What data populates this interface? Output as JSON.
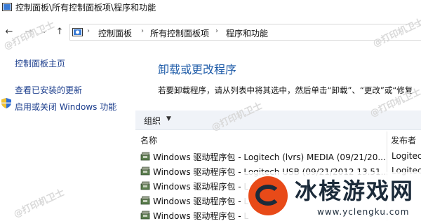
{
  "titlebar": {
    "title": "控制面板\\所有控制面板项\\程序和功能"
  },
  "nav": {
    "back": "←",
    "forward": "→",
    "dropdown": "⌄",
    "up": "↑"
  },
  "address": {
    "crumbs": [
      "控制面板",
      "所有控制面板项",
      "程序和功能"
    ],
    "separator": "›"
  },
  "sidebar": {
    "links": [
      "控制面板主页",
      "查看已安装的更新",
      "启用或关闭 Windows 功能"
    ]
  },
  "main": {
    "heading": "卸载或更改程序",
    "description": "若要卸载程序，请从列表中将其选中，然后单击“卸载”、“更改”或“修复",
    "organize_label": "组织",
    "organize_arrow": "▼",
    "columns": {
      "name": "名称",
      "publisher": "发布者"
    },
    "rows": [
      {
        "name": "Windows 驱动程序包 - Logitech (lvrs) MEDIA  (09/21/20...",
        "publisher": "Logitec"
      },
      {
        "name": "Windows 驱动程序包 - Logitech USB  (09/21/2012 13.51...",
        "publisher": "Logitec"
      },
      {
        "name": "Windows 驱动程序包 - L",
        "publisher": ""
      },
      {
        "name": "Windows 驱动程序包 - L",
        "publisher": ""
      },
      {
        "name": "Windows 驱动程序包 - L",
        "publisher": ""
      }
    ]
  },
  "watermark": {
    "text": "@打印机卫士"
  },
  "logo": {
    "name": "冰棱游戏网",
    "url": "www.yclengku.com"
  },
  "colors": {
    "link": "#1a3c8c",
    "heading": "#1e5ba8",
    "toolbar": "#f0f3f8",
    "logo_accent": "#e84a18"
  }
}
